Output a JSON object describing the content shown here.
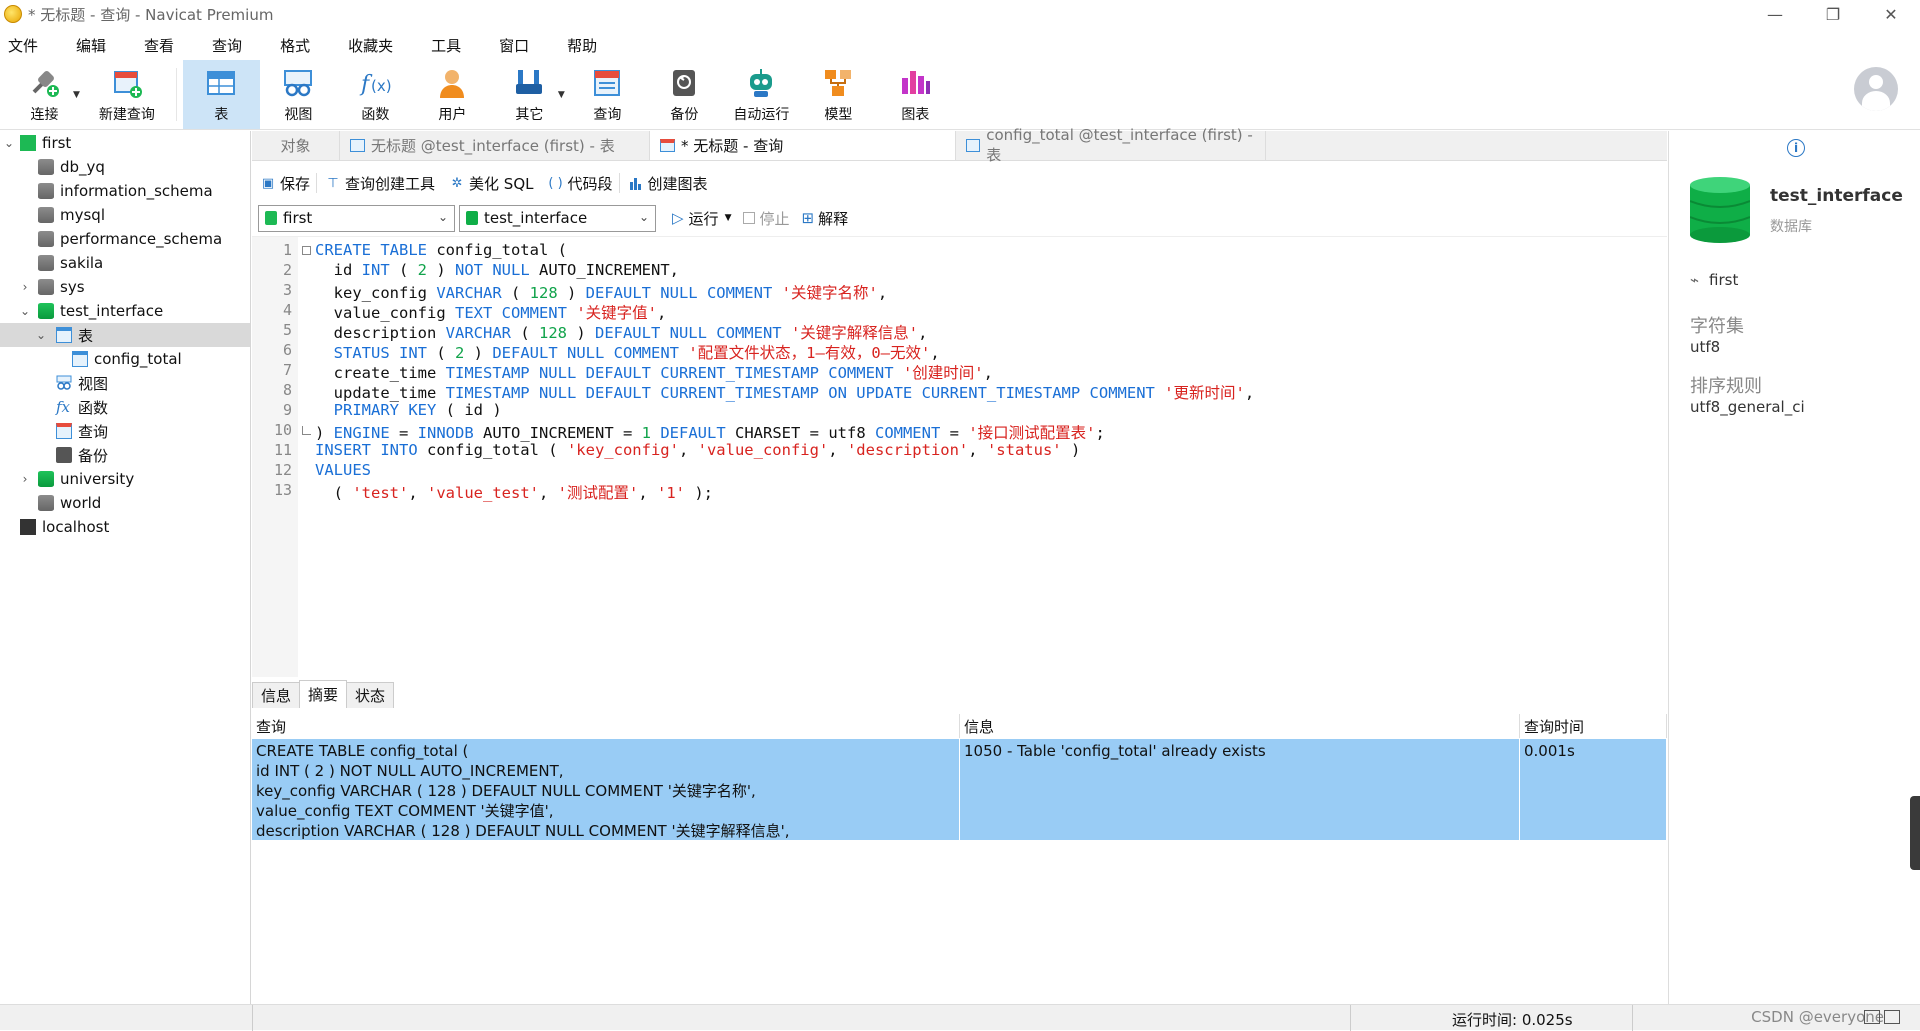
{
  "window": {
    "title": "* 无标题 - 查询 - Navicat Premium",
    "controls": [
      "—",
      "❐",
      "✕"
    ]
  },
  "menu": [
    "文件",
    "编辑",
    "查看",
    "查询",
    "格式",
    "收藏夹",
    "工具",
    "窗口",
    "帮助"
  ],
  "toolbar": {
    "buttons": [
      {
        "label": "连接",
        "icon": "connect-icon"
      },
      {
        "label": "新建查询",
        "icon": "new-query-icon"
      },
      {
        "label": "表",
        "icon": "table-icon"
      },
      {
        "label": "视图",
        "icon": "view-icon"
      },
      {
        "label": "函数",
        "icon": "function-icon"
      },
      {
        "label": "用户",
        "icon": "user-icon"
      },
      {
        "label": "其它",
        "icon": "tools-icon"
      },
      {
        "label": "查询",
        "icon": "query-icon"
      },
      {
        "label": "备份",
        "icon": "backup-icon"
      },
      {
        "label": "自动运行",
        "icon": "robot-icon"
      },
      {
        "label": "模型",
        "icon": "model-icon"
      },
      {
        "label": "图表",
        "icon": "chart-icon"
      }
    ]
  },
  "tree": {
    "items": [
      {
        "label": "first"
      },
      {
        "label": "db_yq"
      },
      {
        "label": "information_schema"
      },
      {
        "label": "mysql"
      },
      {
        "label": "performance_schema"
      },
      {
        "label": "sakila"
      },
      {
        "label": "sys"
      },
      {
        "label": "test_interface"
      },
      {
        "label": "表"
      },
      {
        "label": "config_total"
      },
      {
        "label": "视图"
      },
      {
        "label": "函数"
      },
      {
        "label": "查询"
      },
      {
        "label": "备份"
      },
      {
        "label": "university"
      },
      {
        "label": "world"
      },
      {
        "label": "localhost"
      }
    ]
  },
  "tabs": [
    {
      "label": "对象"
    },
    {
      "label": "无标题 @test_interface (first) - 表"
    },
    {
      "label": "* 无标题 - 查询"
    },
    {
      "label": "config_total @test_interface (first) - 表"
    }
  ],
  "query_toolbar": {
    "save": "保存",
    "builder": "查询创建工具",
    "beautify": "美化 SQL",
    "snippet": "代码段",
    "create_chart": "创建图表",
    "function_icon_glyph": "( )"
  },
  "selectors": {
    "connection": "first",
    "database": "test_interface",
    "run": "运行",
    "stop": "停止",
    "explain": "解释"
  },
  "editor": {
    "lines": [
      [
        [
          "kw",
          "CREATE TABLE"
        ],
        [
          "t",
          " config_total ("
        ]
      ],
      [
        [
          "t",
          "  id "
        ],
        [
          "kw",
          "INT"
        ],
        [
          "t",
          " ( "
        ],
        [
          "num",
          "2"
        ],
        [
          "t",
          " ) "
        ],
        [
          "kw",
          "NOT NULL"
        ],
        [
          "t",
          " AUTO_INCREMENT,"
        ]
      ],
      [
        [
          "t",
          "  key_config "
        ],
        [
          "kw",
          "VARCHAR"
        ],
        [
          "t",
          " ( "
        ],
        [
          "num",
          "128"
        ],
        [
          "t",
          " ) "
        ],
        [
          "kw",
          "DEFAULT NULL COMMENT"
        ],
        [
          "t",
          " "
        ],
        [
          "str",
          "'关键字名称'"
        ],
        [
          "t",
          ","
        ]
      ],
      [
        [
          "t",
          "  value_config "
        ],
        [
          "kw",
          "TEXT COMMENT"
        ],
        [
          "t",
          " "
        ],
        [
          "str",
          "'关键字值'"
        ],
        [
          "t",
          ","
        ]
      ],
      [
        [
          "t",
          "  description "
        ],
        [
          "kw",
          "VARCHAR"
        ],
        [
          "t",
          " ( "
        ],
        [
          "num",
          "128"
        ],
        [
          "t",
          " ) "
        ],
        [
          "kw",
          "DEFAULT NULL COMMENT"
        ],
        [
          "t",
          " "
        ],
        [
          "str",
          "'关键字解释信息'"
        ],
        [
          "t",
          ","
        ]
      ],
      [
        [
          "t",
          "  "
        ],
        [
          "kw",
          "STATUS INT"
        ],
        [
          "t",
          " ( "
        ],
        [
          "num",
          "2"
        ],
        [
          "t",
          " ) "
        ],
        [
          "kw",
          "DEFAULT NULL COMMENT"
        ],
        [
          "t",
          " "
        ],
        [
          "str",
          "'配置文件状态，1—有效，0—无效'"
        ],
        [
          "t",
          ","
        ]
      ],
      [
        [
          "t",
          "  create_time "
        ],
        [
          "kw",
          "TIMESTAMP NULL DEFAULT CURRENT_TIMESTAMP COMMENT"
        ],
        [
          "t",
          " "
        ],
        [
          "str",
          "'创建时间'"
        ],
        [
          "t",
          ","
        ]
      ],
      [
        [
          "t",
          "  update_time "
        ],
        [
          "kw",
          "TIMESTAMP NULL DEFAULT CURRENT_TIMESTAMP ON UPDATE CURRENT_TIMESTAMP COMMENT"
        ],
        [
          "t",
          " "
        ],
        [
          "str",
          "'更新时间'"
        ],
        [
          "t",
          ","
        ]
      ],
      [
        [
          "t",
          "  "
        ],
        [
          "kw",
          "PRIMARY KEY"
        ],
        [
          "t",
          " ( id )"
        ]
      ],
      [
        [
          "t",
          ") "
        ],
        [
          "kw",
          "ENGINE"
        ],
        [
          "t",
          " = "
        ],
        [
          "kw",
          "INNODB"
        ],
        [
          "t",
          " AUTO_INCREMENT = "
        ],
        [
          "num",
          "1"
        ],
        [
          "t",
          " "
        ],
        [
          "kw",
          "DEFAULT"
        ],
        [
          "t",
          " CHARSET = utf8 "
        ],
        [
          "kw",
          "COMMENT"
        ],
        [
          "t",
          " = "
        ],
        [
          "str",
          "'接口测试配置表'"
        ],
        [
          "t",
          ";"
        ]
      ],
      [
        [
          "kw",
          "INSERT INTO"
        ],
        [
          "t",
          " config_total ( "
        ],
        [
          "str",
          "'key_config'"
        ],
        [
          "t",
          ", "
        ],
        [
          "str",
          "'value_config'"
        ],
        [
          "t",
          ", "
        ],
        [
          "str",
          "'description'"
        ],
        [
          "t",
          ", "
        ],
        [
          "str",
          "'status'"
        ],
        [
          "t",
          " )"
        ]
      ],
      [
        [
          "kw",
          "VALUES"
        ]
      ],
      [
        [
          "t",
          "  ( "
        ],
        [
          "str",
          "'test'"
        ],
        [
          "t",
          ", "
        ],
        [
          "str",
          "'value_test'"
        ],
        [
          "t",
          ", "
        ],
        [
          "str",
          "'测试配置'"
        ],
        [
          "t",
          ", "
        ],
        [
          "str",
          "'1'"
        ],
        [
          "t",
          " );"
        ]
      ]
    ]
  },
  "result_tabs": [
    "信息",
    "摘要",
    "状态"
  ],
  "result_grid": {
    "columns": [
      "查询",
      "信息",
      "查询时间"
    ],
    "row": {
      "query_lines": [
        "CREATE TABLE config_total (",
        "id INT ( 2 ) NOT NULL AUTO_INCREMENT,",
        "key_config VARCHAR ( 128 ) DEFAULT NULL COMMENT '关键字名称',",
        "value_config TEXT COMMENT '关键字值',",
        "description VARCHAR ( 128 ) DEFAULT NULL COMMENT '关键字解释信息',"
      ],
      "message": "1050 - Table 'config_total' already exists",
      "time": "0.001s"
    }
  },
  "right_panel": {
    "db_name": "test_interface",
    "db_type": "数据库",
    "connection": "first",
    "charset_label": "字符集",
    "charset_value": "utf8",
    "collation_label": "排序规则",
    "collation_value": "utf8_general_ci"
  },
  "status": {
    "run_time": "运行时间: 0.025s",
    "watermark": "CSDN @everyone"
  },
  "colors": {
    "keyword": "#1a6fd6",
    "string": "#d8231f",
    "number": "#11a34b",
    "selection": "#99ccf5",
    "db_green": "#0fae47"
  }
}
